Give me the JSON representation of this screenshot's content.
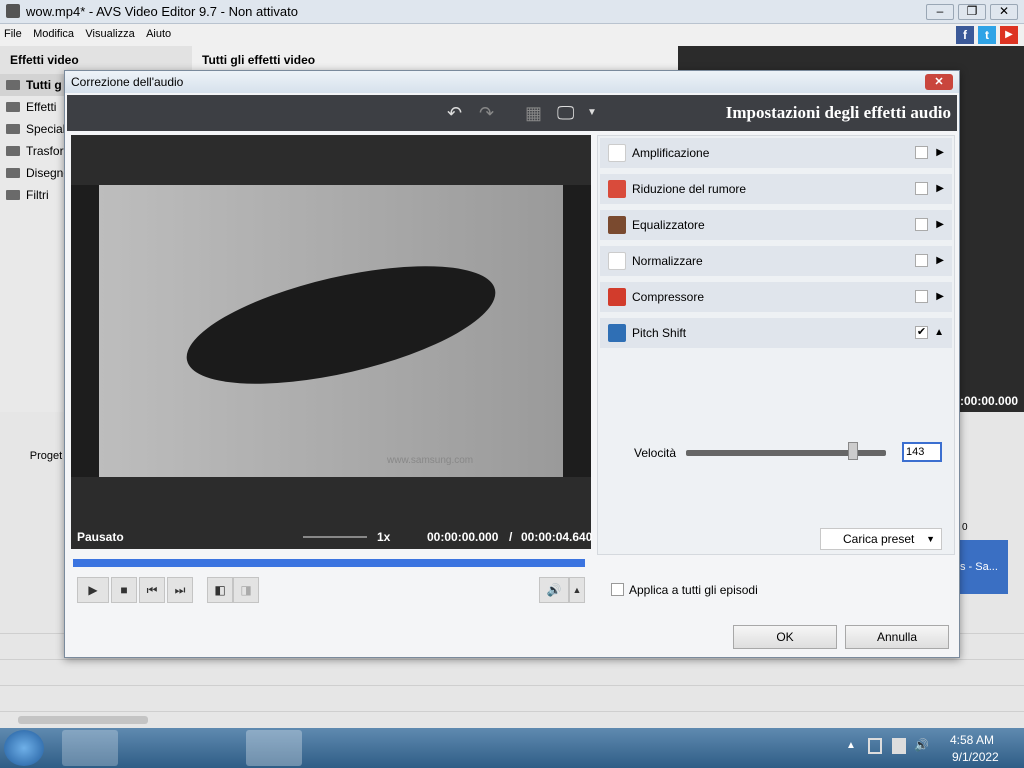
{
  "window": {
    "title": "wow.mp4* - AVS Video Editor 9.7 - Non attivato"
  },
  "menu": [
    "File",
    "Modifica",
    "Visualizza",
    "Aiuto"
  ],
  "left_panel": {
    "header": "Effetti video",
    "items": [
      "Tutti g",
      "Effetti",
      "Speciali",
      "Trasfor",
      "Disegno",
      "Filtri"
    ]
  },
  "mid_header": "Tutti gli effetti video",
  "bg_timecode": ":00:00.000",
  "bg_project_label": "Proget",
  "bg_clip_label": "s - Sa...",
  "bg_ruler": "0",
  "dialog": {
    "title": "Correzione dell'audio",
    "panel_title": "Impostazioni degli effetti audio",
    "video": {
      "watermark": "www.samsung.com",
      "status": "Pausato",
      "speed": "1x",
      "time_current": "00:00:00.000",
      "time_sep": "/",
      "time_total": "00:00:04.640"
    },
    "effects": [
      {
        "label": "Amplificazione",
        "checked": false,
        "color": "#ffffff"
      },
      {
        "label": "Riduzione del rumore",
        "checked": false,
        "color": "#d94b3b"
      },
      {
        "label": "Equalizzatore",
        "checked": false,
        "color": "#7a4a2f"
      },
      {
        "label": "Normalizzare",
        "checked": false,
        "color": "#ffffff"
      },
      {
        "label": "Compressore",
        "checked": false,
        "color": "#d23c2c"
      },
      {
        "label": "Pitch Shift",
        "checked": true,
        "color": "#2f6fb5"
      }
    ],
    "velocity": {
      "label": "Velocità",
      "value": "143",
      "level": 0.82
    },
    "preset_label": "Carica preset",
    "apply_all": "Applica a tutti gli episodi",
    "ok": "OK",
    "cancel": "Annulla"
  },
  "taskbar": {
    "time": "4:58 AM",
    "date": "9/1/2022"
  }
}
